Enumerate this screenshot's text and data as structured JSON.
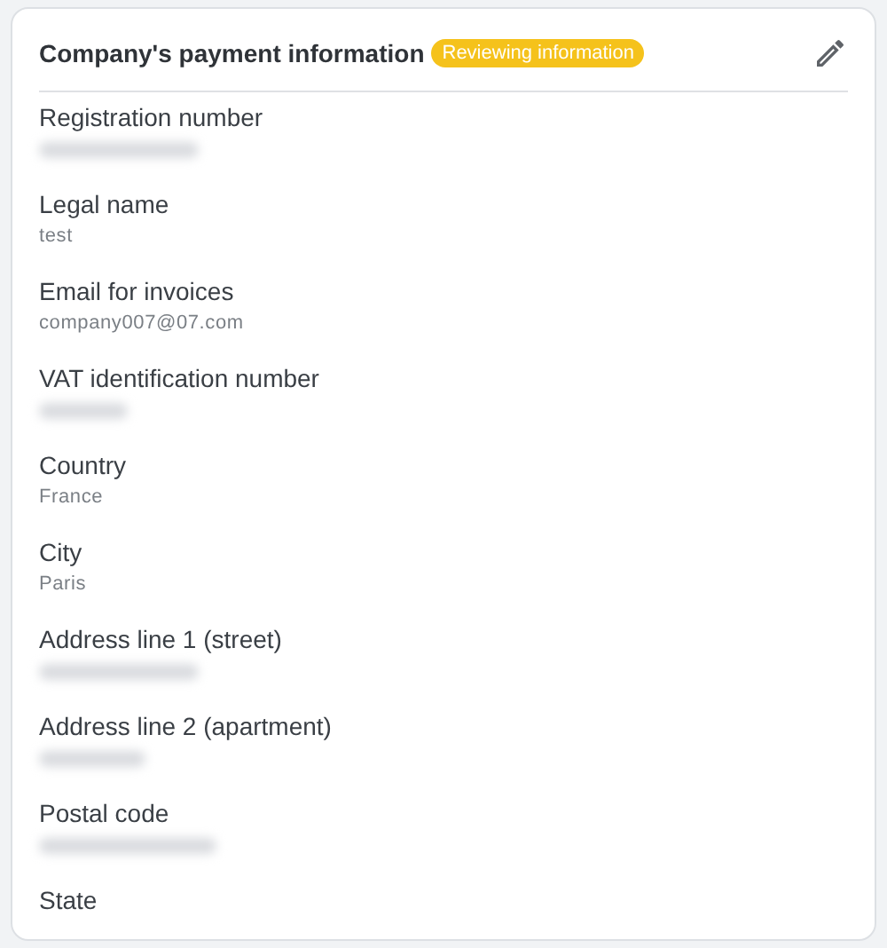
{
  "card": {
    "title": "Company's payment information",
    "status_badge": "Reviewing information",
    "editable": true
  },
  "fields": [
    {
      "label": "Registration number",
      "redacted": true
    },
    {
      "label": "Legal name",
      "value": "test",
      "redacted": false
    },
    {
      "label": "Email for invoices",
      "value": "company007@07.com",
      "redacted": false
    },
    {
      "label": "VAT identification number",
      "redacted": true
    },
    {
      "label": "Country",
      "value": "France",
      "redacted": false
    },
    {
      "label": "City",
      "value": "Paris",
      "redacted": false
    },
    {
      "label": "Address line 1 (street)",
      "redacted": true
    },
    {
      "label": "Address line 2 (apartment)",
      "redacted": true
    },
    {
      "label": "Postal code",
      "redacted": true
    },
    {
      "label": "State",
      "redacted": false
    }
  ]
}
